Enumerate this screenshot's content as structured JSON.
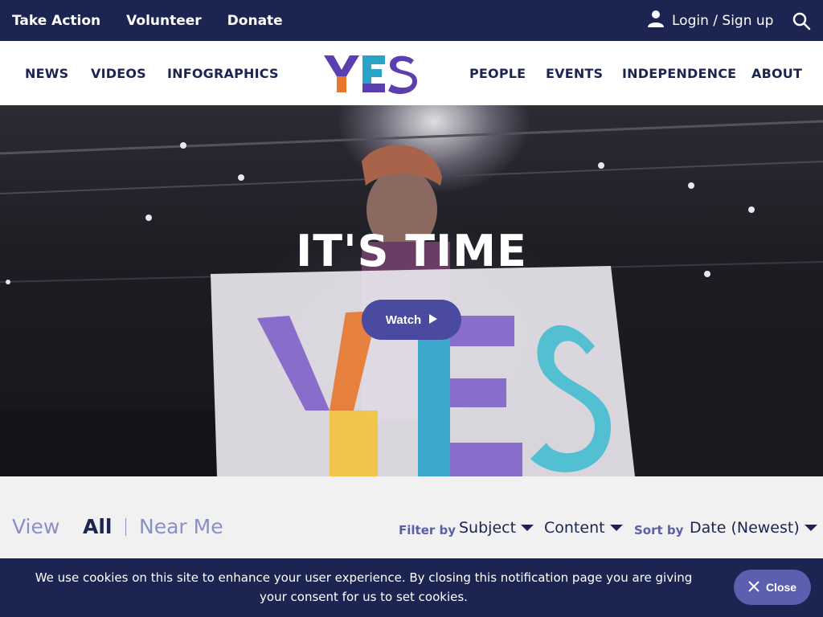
{
  "topbar": {
    "links": [
      "Take Action",
      "Volunteer",
      "Donate"
    ],
    "login_label": "Login / Sign up",
    "user_icon": "user-icon",
    "search_icon": "search-icon"
  },
  "nav": {
    "left": [
      "NEWS",
      "VIDEOS",
      "INFOGRAPHICS"
    ],
    "right": [
      "PEOPLE",
      "EVENTS",
      "INDEPENDENCE",
      "ABOUT"
    ]
  },
  "logo": {
    "text": "YES",
    "colors": [
      "#5b3fb0",
      "#e8772e",
      "#2aa3c9",
      "#5b3fb0"
    ]
  },
  "hero": {
    "title": "IT'S TIME",
    "watch_label": "Watch",
    "watch_icon": "play-icon"
  },
  "filters": {
    "view_label": "View",
    "view_all": "All",
    "view_near": "Near Me",
    "filter_label": "Filter by",
    "subject": "Subject",
    "content": "Content",
    "sort_label": "Sort by",
    "sort_value": "Date (Newest)"
  },
  "cookie": {
    "message": "We use cookies on this site to enhance your user experience. By closing this notification page you are giving your consent for us to set cookies.",
    "close_label": "Close",
    "close_icon": "close-icon"
  },
  "colors": {
    "navy": "#1c2451",
    "accent": "#4a4aa0",
    "muted": "#8a8fc6"
  }
}
